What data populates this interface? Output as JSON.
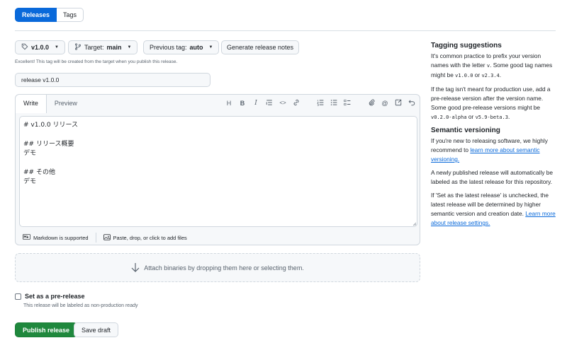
{
  "top_tabs": {
    "releases": "Releases",
    "tags": "Tags"
  },
  "release_form": {
    "tag_pill": "v1.0.0",
    "target_label": "Target:",
    "target_value": "main",
    "previous_tag_label": "Previous tag:",
    "previous_tag_value": "auto",
    "generate_notes": "Generate release notes",
    "tag_hint": "Excellent! This tag will be created from the target when you publish this release.",
    "title_value": "release v1.0.0"
  },
  "editor": {
    "tab_write": "Write",
    "tab_preview": "Preview",
    "toolbar_icons": [
      "heading-icon",
      "bold-icon",
      "italic-icon",
      "quote-icon",
      "code-icon",
      "link-icon",
      "ordered-list-icon",
      "unordered-list-icon",
      "task-list-icon",
      "attach-icon",
      "mention-icon",
      "reference-icon",
      "undo-icon"
    ],
    "body": "# v1.0.0 リリース\n\n## リリース概要\nデモ\n\n## その他\nデモ",
    "markdown_supported": "Markdown is supported",
    "paste_hint": "Paste, drop, or click to add files"
  },
  "attach": {
    "text": "Attach binaries by dropping them here or selecting them."
  },
  "prerelease": {
    "label": "Set as a pre-release",
    "sub": "This release will be labeled as non-production ready"
  },
  "actions": {
    "publish": "Publish release",
    "save_draft": "Save draft"
  },
  "sidebar": {
    "tagging_title": "Tagging suggestions",
    "tagging_p1_a": "It's common practice to prefix your version names with the letter ",
    "tagging_p1_v": "v",
    "tagging_p1_b": ". Some good tag names might be ",
    "tagging_p1_code1": "v1.0.0",
    "tagging_p1_or": " or ",
    "tagging_p1_code2": "v2.3.4",
    "tagging_p1_end": ".",
    "tagging_p2_a": "If the tag isn't meant for production use, add a pre-release version after the version name. Some good pre-release versions might be ",
    "tagging_p2_code1": "v0.2.0-alpha",
    "tagging_p2_or": " or ",
    "tagging_p2_code2": "v5.9-beta.3",
    "tagging_p2_end": ".",
    "semver_title": "Semantic versioning",
    "semver_p1_a": "If you're new to releasing software, we highly recommend to ",
    "semver_p1_link": "learn more about semantic versioning.",
    "semver_p2": "A newly published release will automatically be labeled as the latest release for this repository.",
    "semver_p3_a": "If 'Set as the latest release' is unchecked, the latest release will be determined by higher semantic version and creation date. ",
    "semver_p3_link": "Learn more about release settings."
  }
}
